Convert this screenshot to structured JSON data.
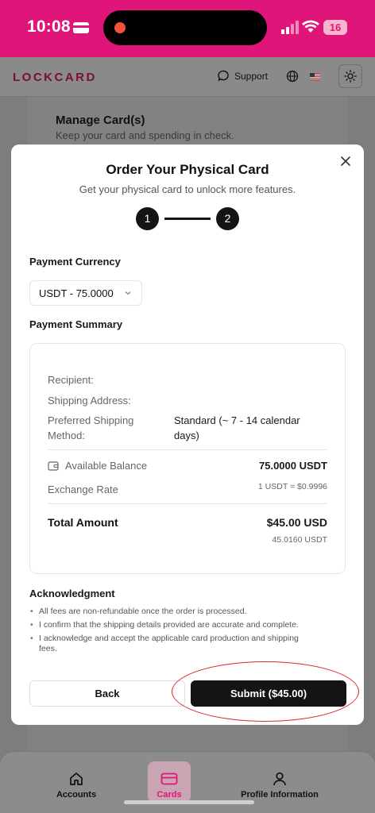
{
  "status_bar": {
    "time": "10:08",
    "battery": "16"
  },
  "topnav": {
    "logo": "LOCKCARD",
    "support": "Support"
  },
  "background": {
    "title": "Manage Card(s)",
    "subtitle": "Keep your card and spending in check."
  },
  "modal": {
    "title": "Order Your Physical Card",
    "subtitle": "Get your physical card to unlock more features.",
    "steps": [
      "1",
      "2"
    ],
    "payment_currency_label": "Payment Currency",
    "currency_selected": "USDT - 75.0000",
    "payment_summary_label": "Payment Summary",
    "summary": {
      "recipient_label": "Recipient:",
      "shipping_address_label": "Shipping Address:",
      "shipping_method_label_1": "Preferred Shipping",
      "shipping_method_label_2": "Method:",
      "shipping_method_value_1": "Standard (~ 7 - 14 calendar",
      "shipping_method_value_2": "days)",
      "available_balance_label": "Available Balance",
      "available_balance_value": "75.0000 USDT",
      "exchange_rate_label": "Exchange Rate",
      "exchange_rate_value": "1 USDT = $0.9996",
      "total_label": "Total Amount",
      "total_value": "$45.00 USD",
      "total_usdt": "45.0160 USDT"
    },
    "acknowledgment_title": "Acknowledgment",
    "acknowledgments": [
      "All fees are non-refundable once the order is processed.",
      "I confirm that the shipping details provided are accurate and complete.",
      "I acknowledge and accept the applicable card production and shipping fees."
    ],
    "back_label": "Back",
    "submit_label": "Submit ($45.00)"
  },
  "tabbar": {
    "items": [
      {
        "label": "Accounts",
        "icon": "home-icon"
      },
      {
        "label": "Cards",
        "icon": "card-icon",
        "active": true
      },
      {
        "label": "Profile Information",
        "icon": "person-icon"
      }
    ]
  },
  "colors": {
    "brand": "#e0157a",
    "active_tab": "#e0157a",
    "primary_button": "#141414",
    "highlight": "#e0252c"
  }
}
